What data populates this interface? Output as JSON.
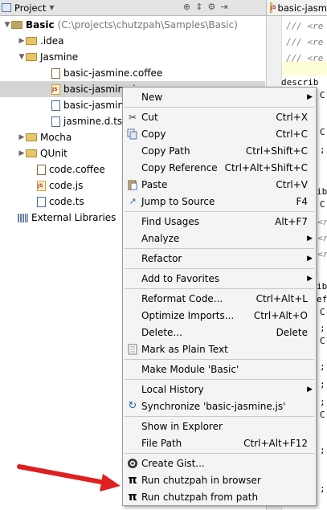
{
  "toolbar": {
    "project_label": "Project",
    "editor_tab_label": "basic-jasm"
  },
  "tree": {
    "root": {
      "name": "Basic",
      "path": "(C:\\projects\\chutzpah\\Samples\\Basic)"
    },
    "items": [
      {
        "label": ".idea"
      },
      {
        "label": "Jasmine"
      },
      {
        "label": "basic-jasmine.coffee"
      },
      {
        "label": "basic-jasmine.js"
      },
      {
        "label": "basic-jasmine"
      },
      {
        "label": "jasmine.d.ts"
      },
      {
        "label": "Mocha"
      },
      {
        "label": "QUnit"
      },
      {
        "label": "code.coffee"
      },
      {
        "label": "code.js"
      },
      {
        "label": "code.ts"
      },
      {
        "label": "External Libraries"
      }
    ]
  },
  "editor": {
    "lines": [
      "/// <re",
      "/// <re",
      "/// <re",
      "describ",
      "C(",
      "C(",
      ";",
      "ib",
      "C(",
      "/ <r",
      "/ <r",
      "/ <r",
      "ib",
      "ef",
      "C(",
      ";",
      "C(",
      ";",
      ";",
      ";",
      "C(",
      ";",
      ";"
    ]
  },
  "menu": {
    "items": [
      {
        "label": "New",
        "shortcut": ""
      },
      {
        "label": "Cut",
        "shortcut": "Ctrl+X"
      },
      {
        "label": "Copy",
        "shortcut": "Ctrl+C"
      },
      {
        "label": "Copy Path",
        "shortcut": "Ctrl+Shift+C"
      },
      {
        "label": "Copy Reference",
        "shortcut": "Ctrl+Alt+Shift+C"
      },
      {
        "label": "Paste",
        "shortcut": "Ctrl+V"
      },
      {
        "label": "Jump to Source",
        "shortcut": "F4"
      },
      {
        "label": "Find Usages",
        "shortcut": "Alt+F7"
      },
      {
        "label": "Analyze",
        "shortcut": ""
      },
      {
        "label": "Refactor",
        "shortcut": ""
      },
      {
        "label": "Add to Favorites",
        "shortcut": ""
      },
      {
        "label": "Reformat Code...",
        "shortcut": "Ctrl+Alt+L"
      },
      {
        "label": "Optimize Imports...",
        "shortcut": "Ctrl+Alt+O"
      },
      {
        "label": "Delete...",
        "shortcut": "Delete"
      },
      {
        "label": "Mark as Plain Text",
        "shortcut": ""
      },
      {
        "label": "Make Module 'Basic'",
        "shortcut": ""
      },
      {
        "label": "Local History",
        "shortcut": ""
      },
      {
        "label": "Synchronize 'basic-jasmine.js'",
        "shortcut": ""
      },
      {
        "label": "Show in Explorer",
        "shortcut": ""
      },
      {
        "label": "File Path",
        "shortcut": "Ctrl+Alt+F12"
      },
      {
        "label": "Create Gist...",
        "shortcut": ""
      },
      {
        "label": "Run chutzpah in browser",
        "shortcut": ""
      },
      {
        "label": "Run chutzpah from path",
        "shortcut": ""
      }
    ]
  },
  "colors": {
    "annotation_arrow": "#e02020",
    "selection": "#d4d4d4",
    "menu_bg": "#f4f4f4"
  }
}
